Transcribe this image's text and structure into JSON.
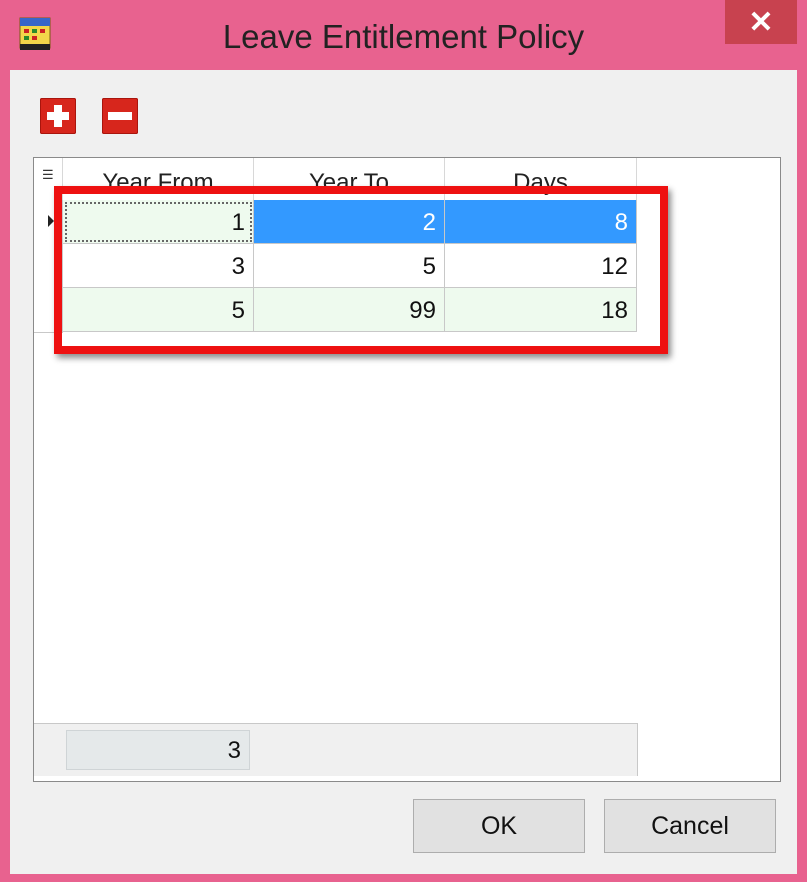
{
  "window": {
    "title": "Leave Entitlement Policy",
    "close_glyph": "✕",
    "app_icon": "calendar-app-icon"
  },
  "toolbar": {
    "add_icon": "plus-icon",
    "remove_icon": "minus-icon",
    "accent_color": "#d7261c"
  },
  "grid": {
    "columns": [
      "Year From",
      "Year To",
      "Days"
    ],
    "rows": [
      [
        "1",
        "2",
        "8"
      ],
      [
        "3",
        "5",
        "12"
      ],
      [
        "5",
        "99",
        "18"
      ]
    ],
    "footer_count": "3",
    "selection_color": "#3399ff",
    "alt_row_color": "#eefaee",
    "highlight_color": "#ee1111"
  },
  "buttons": {
    "ok_label": "OK",
    "cancel_label": "Cancel"
  }
}
